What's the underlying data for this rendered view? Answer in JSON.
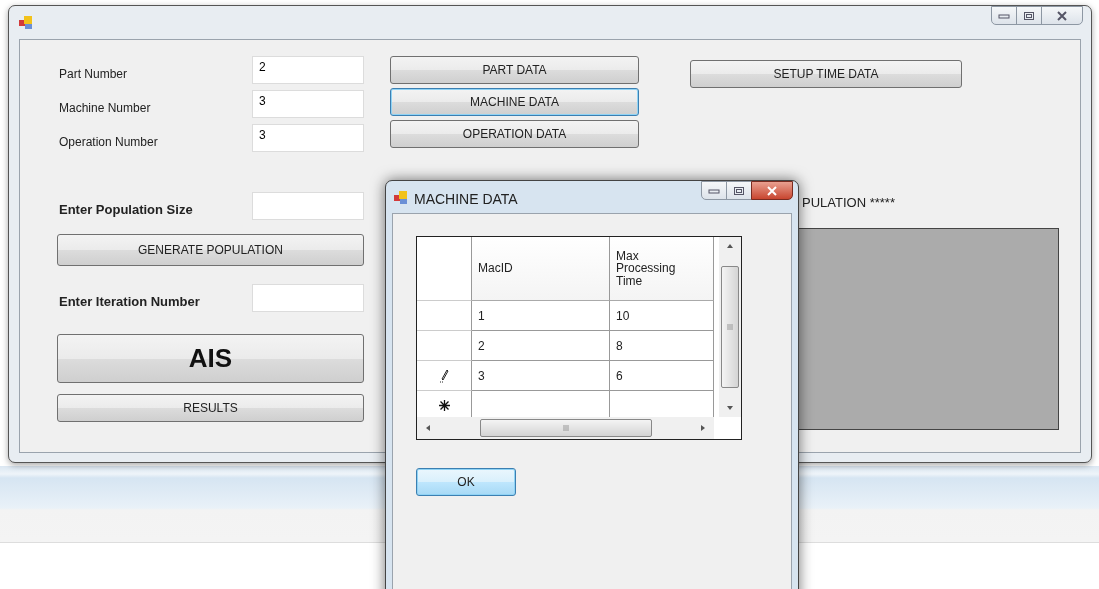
{
  "inputs": [
    {
      "label": "Part Number",
      "value": "2"
    },
    {
      "label": "Machine Number",
      "value": "3"
    },
    {
      "label": "Operation Number",
      "value": "3"
    }
  ],
  "population": {
    "label": "Enter Population Size",
    "button": "GENERATE POPULATION"
  },
  "iteration": {
    "label": "Enter Iteration Number"
  },
  "ais_button": "AIS",
  "results_button": "RESULTS",
  "data_buttons": [
    {
      "label": "PART DATA",
      "focused": false
    },
    {
      "label": "MACHINE DATA",
      "focused": true
    },
    {
      "label": "OPERATION DATA",
      "focused": false
    }
  ],
  "setup_button": "SETUP TIME DATA",
  "population_heading": "PULATION *****",
  "dialog": {
    "title": "MACHINE DATA",
    "columns": [
      "MacID",
      "Max Processing Time"
    ],
    "rows": [
      {
        "kind": "data",
        "editing": false,
        "cells": [
          "1",
          "10"
        ]
      },
      {
        "kind": "data",
        "editing": false,
        "cells": [
          "2",
          "8"
        ]
      },
      {
        "kind": "data",
        "editing": true,
        "cells": [
          "3",
          "6"
        ]
      },
      {
        "kind": "new_row",
        "editing": false
      }
    ],
    "ok_button": {
      "label": "OK",
      "focused": true
    }
  }
}
